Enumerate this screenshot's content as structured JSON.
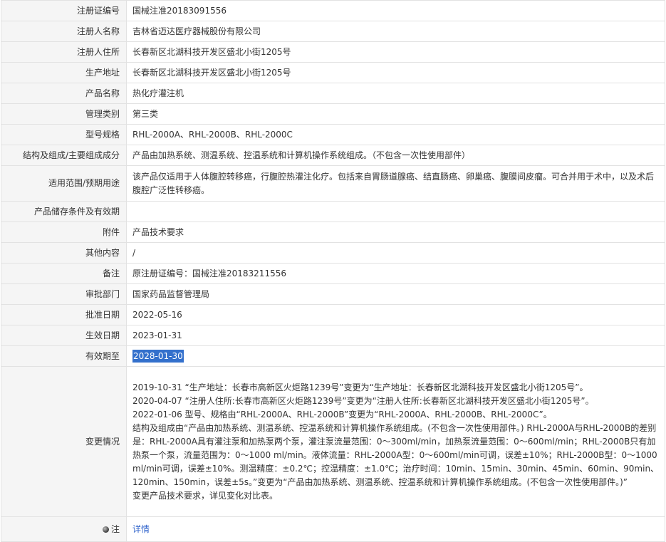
{
  "rows": [
    {
      "label": "注册证编号",
      "value": "国械注准20183091556"
    },
    {
      "label": "注册人名称",
      "value": "吉林省迈达医疗器械股份有限公司"
    },
    {
      "label": "注册人住所",
      "value": "长春新区北湖科技开发区盛北小街1205号"
    },
    {
      "label": "生产地址",
      "value": "长春新区北湖科技开发区盛北小街1205号"
    },
    {
      "label": "产品名称",
      "value": "热化疗灌注机"
    },
    {
      "label": "管理类别",
      "value": "第三类"
    },
    {
      "label": "型号规格",
      "value": "RHL-2000A、RHL-2000B、RHL-2000C"
    },
    {
      "label": "结构及组成/主要组成成分",
      "value": "产品由加热系统、测温系统、控温系统和计算机操作系统组成。（不包含一次性使用部件）"
    },
    {
      "label": "适用范围/预期用途",
      "value": "该产品仅适用于人体腹腔转移癌，行腹腔热灌注化疗。包括来自胃肠道腺癌、结直肠癌、卵巢癌、腹膜间皮瘤。可合并用于术中，以及术后腹腔广泛性转移癌。"
    },
    {
      "label": "产品储存条件及有效期",
      "value": ""
    },
    {
      "label": "附件",
      "value": "产品技术要求"
    },
    {
      "label": "其他内容",
      "value": "/"
    },
    {
      "label": "备注",
      "value": "原注册证编号：国械注准20183211556"
    },
    {
      "label": "审批部门",
      "value": "国家药品监督管理局"
    },
    {
      "label": "批准日期",
      "value": "2022-05-16"
    },
    {
      "label": "生效日期",
      "value": "2023-01-31"
    },
    {
      "label": "有效期至",
      "value": "2028-01-30"
    }
  ],
  "changes": {
    "label": "变更情况",
    "lines": [
      "2019-10-31 “生产地址：长春市高新区火炬路1239号”变更为“生产地址：长春新区北湖科技开发区盛北小街1205号”。",
      "2020-04-07 “注册人住所:长春市高新区火炬路1239号”变更为“注册人住所:长春新区北湖科技开发区盛北小街1205号”。",
      "2022-01-06 型号、规格由“RHL-2000A、RHL-2000B”变更为“RHL-2000A、RHL-2000B、RHL-2000C”。",
      "结构及组成由“产品由加热系统、测温系统、控温系统和计算机操作系统组成。(不包含一次性使用部件。) RHL-2000A与RHL-2000B的差别是：RHL-2000A具有灌注泵和加热泵两个泵，灌注泵流量范围：0～300ml/min，加热泵流量范围：0～600ml/min；RHL-2000B只有加热泵一个泵，流量范围为：0～1000 ml/min。液体流量：RHL-2000A型：0～600ml/min可调，误差±10%；RHL-2000B型：0～1000ml/min可调，误差±10%。测温精度：±0.2℃；控温精度：±1.0℃；治疗时间：10min、15min、30min、45min、60min、90min、120min、150min，误差±5s。”变更为“产品由加热系统、测温系统、控温系统和计算机操作系统组成。(不包含一次性使用部件。)”",
      "变更产品技术要求，详见变化对比表。"
    ]
  },
  "note": {
    "label": "注",
    "icon": "bulb-icon",
    "link": "详情"
  }
}
